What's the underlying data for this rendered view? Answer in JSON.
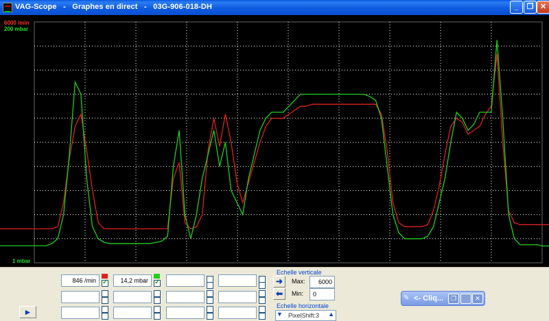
{
  "window": {
    "title": "VAG-Scope   -   Graphes en direct   -   03G-906-018-DH",
    "minimize_label": "_",
    "restore_label": "❐",
    "close_label": "✕"
  },
  "scope": {
    "channel1_max_label": "6000 /min",
    "channel2_max_label": "200 mbar",
    "min_label": "1 mbar",
    "colors": {
      "channel1": "#e02020",
      "channel2": "#20d020",
      "grid": "#ffffff",
      "background": "#000000"
    }
  },
  "chart_data": {
    "type": "line",
    "title": "",
    "grid": true,
    "series": [
      {
        "name": "6000 /min",
        "color": "#e02020",
        "values": [
          846,
          846,
          846,
          846,
          846,
          846,
          846,
          846,
          846,
          850,
          900,
          1500,
          2600,
          3400,
          3700,
          2800,
          1800,
          1000,
          850,
          846,
          846,
          846,
          846,
          846,
          846,
          846,
          846,
          846,
          846,
          850,
          2100,
          2500,
          1000,
          846,
          900,
          1200,
          2800,
          3600,
          2900,
          3700,
          3000,
          2000,
          1500,
          2000,
          2500,
          3000,
          3400,
          3600,
          3600,
          3600,
          3700,
          3800,
          3900,
          3900,
          3950,
          3950,
          3950,
          3950,
          3950,
          3950,
          3950,
          3950,
          3950,
          3950,
          3950,
          3950,
          3700,
          2800,
          1500,
          1000,
          900,
          900,
          900,
          900,
          950,
          1300,
          1900,
          2700,
          3400,
          3600,
          3500,
          3200,
          3300,
          3400,
          3700,
          3900,
          5200,
          3000,
          1300,
          1000,
          950,
          950,
          950,
          950,
          950,
          950
        ]
      },
      {
        "name": "200 mbar",
        "color": "#20d020",
        "values": [
          14.2,
          14.2,
          14.2,
          14.2,
          14.2,
          14.2,
          14.2,
          14.2,
          14.2,
          16,
          20,
          40,
          90,
          150,
          140,
          70,
          30,
          20,
          17,
          16,
          16,
          16,
          16,
          16,
          16,
          16,
          16,
          17,
          18,
          22,
          80,
          110,
          40,
          20,
          40,
          70,
          90,
          110,
          80,
          100,
          60,
          50,
          40,
          70,
          90,
          110,
          120,
          125,
          125,
          125,
          130,
          135,
          140,
          140,
          140,
          140,
          140,
          140,
          140,
          140,
          140,
          140,
          140,
          140,
          138,
          135,
          120,
          80,
          40,
          25,
          20,
          20,
          20,
          20,
          22,
          30,
          50,
          70,
          100,
          125,
          120,
          110,
          115,
          125,
          125,
          125,
          185,
          120,
          40,
          20,
          15,
          15,
          15,
          15,
          14,
          14
        ]
      }
    ]
  },
  "controls": {
    "row1": {
      "field1": "846 /min",
      "field2": "14,2 mbar",
      "field3": "",
      "field4": ""
    },
    "row2": {
      "field1": "",
      "field2": "",
      "field3": "",
      "field4": ""
    },
    "row3": {
      "field1": "",
      "field2": "",
      "field3": "",
      "field4": ""
    },
    "play_label": "►",
    "vertical_scale_label": "Echelle verticale",
    "max_label": "Max:",
    "max_value": "6000",
    "min_label": "Min:",
    "min_value": "0",
    "horizontal_scale_label": "Echelle horizontale",
    "pixelshift_value": "PixelShift:3",
    "arrow_right": "➜",
    "arrow_left": "⬅",
    "spin_down": "▼",
    "spin_up": "▲"
  },
  "floating_bar": {
    "label": "<- Cliq...",
    "restore": "❐",
    "close": "✕"
  }
}
